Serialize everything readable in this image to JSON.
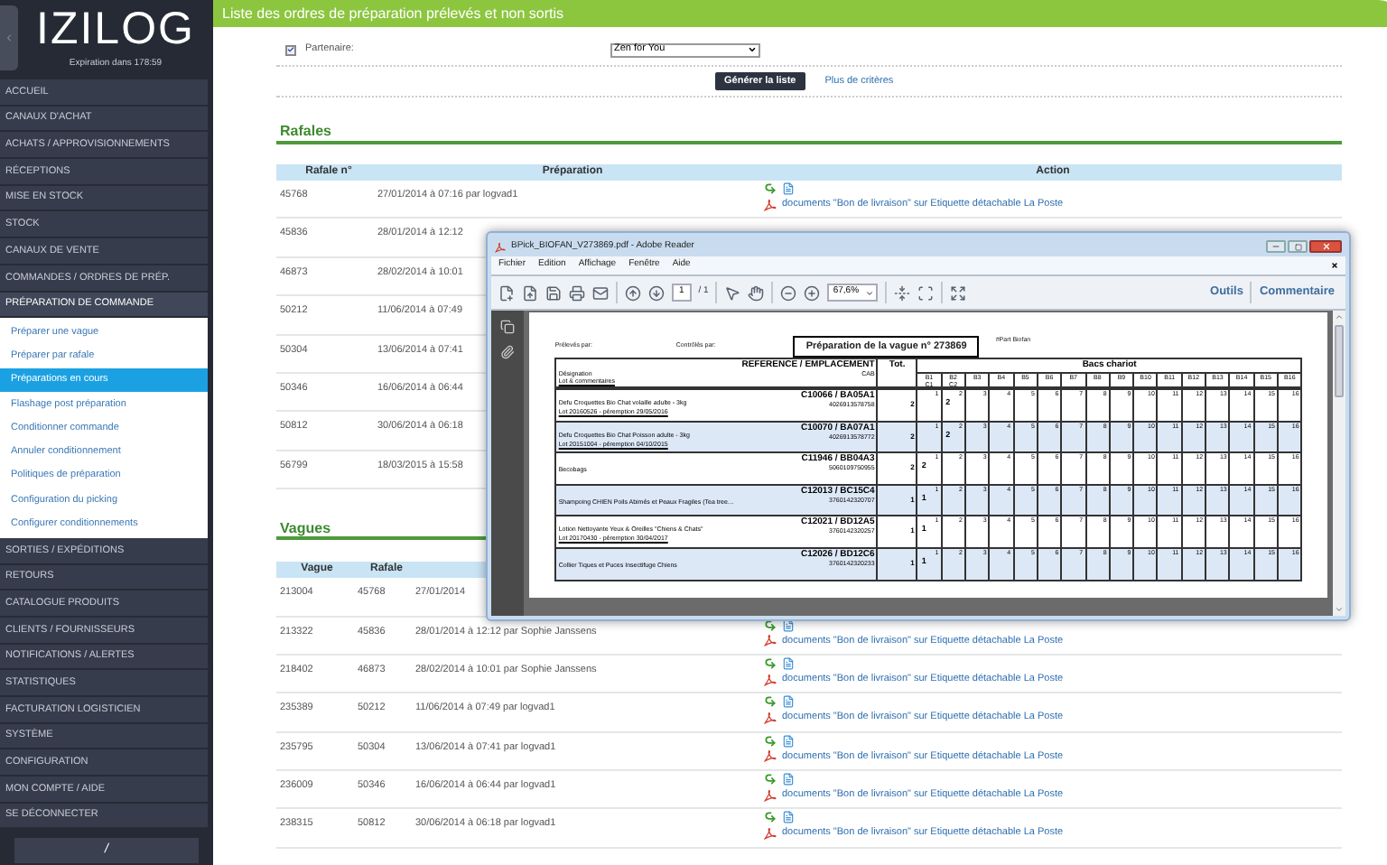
{
  "sidebar": {
    "logo": "IZILOG",
    "expiry": "Expiration dans 178:59",
    "items": [
      {
        "label": "ACCUEIL",
        "expanded": false
      },
      {
        "label": "CANAUX D'ACHAT",
        "expanded": false
      },
      {
        "label": "ACHATS / APPROVISIONNEMENTS",
        "expanded": false
      },
      {
        "label": "RÉCEPTIONS",
        "expanded": false
      },
      {
        "label": "MISE EN STOCK",
        "expanded": false
      },
      {
        "label": "STOCK",
        "expanded": false
      },
      {
        "label": "CANAUX DE VENTE",
        "expanded": false
      },
      {
        "label": "COMMANDES / ORDRES DE PRÉP.",
        "expanded": false
      },
      {
        "label": "PRÉPARATION DE COMMANDE",
        "expanded": true,
        "children": [
          {
            "label": "Préparer une vague",
            "selected": false
          },
          {
            "label": "Préparer par rafale",
            "selected": false
          },
          {
            "label": "Préparations en cours",
            "selected": true
          },
          {
            "label": "Flashage post préparation",
            "selected": false
          },
          {
            "label": "Conditionner commande",
            "selected": false
          },
          {
            "label": "Annuler conditionnement",
            "selected": false
          },
          {
            "label": "Politiques de préparation",
            "selected": false
          },
          {
            "label": "Configuration du picking",
            "selected": false
          },
          {
            "label": "Configurer conditionnements",
            "selected": false
          }
        ]
      },
      {
        "label": "SORTIES / EXPÉDITIONS",
        "expanded": false
      },
      {
        "label": "RETOURS",
        "expanded": false
      },
      {
        "label": "CATALOGUE PRODUITS",
        "expanded": false
      },
      {
        "label": "CLIENTS / FOURNISSEURS",
        "expanded": false
      },
      {
        "label": "NOTIFICATIONS / ALERTES",
        "expanded": false
      },
      {
        "label": "STATISTIQUES",
        "expanded": false
      },
      {
        "label": "FACTURATION LOGISTICIEN",
        "expanded": false
      },
      {
        "label": "SYSTÈME",
        "expanded": false
      },
      {
        "label": "CONFIGURATION",
        "expanded": false
      },
      {
        "label": "MON COMPTE / AIDE",
        "expanded": false
      },
      {
        "label": "SE DÉCONNECTER",
        "expanded": false
      }
    ],
    "footer": "/"
  },
  "header": {
    "title": "Liste des ordres de préparation prélevés et non sortis"
  },
  "filter": {
    "checked": true,
    "label": "Partenaire:",
    "value": "Zen for You",
    "button": "Générer la liste",
    "more_link": "Plus de critères"
  },
  "rafales": {
    "title": "Rafales",
    "columns": [
      "Rafale n°",
      "Préparation",
      "Action"
    ],
    "rows": [
      {
        "id": "45768",
        "preparation": "27/01/2014 à 07:16 par logvad1",
        "link": "documents \"Bon de livraison\" sur Etiquette détachable La Poste"
      },
      {
        "id": "45836",
        "preparation": "28/01/2014 à 12:12"
      },
      {
        "id": "46873",
        "preparation": "28/02/2014 à 10:01"
      },
      {
        "id": "50212",
        "preparation": "11/06/2014 à 07:49"
      },
      {
        "id": "50304",
        "preparation": "13/06/2014 à 07:41"
      },
      {
        "id": "50346",
        "preparation": "16/06/2014 à 06:44"
      },
      {
        "id": "50812",
        "preparation": "30/06/2014 à 06:18"
      },
      {
        "id": "56799",
        "preparation": "18/03/2015 à 15:58"
      }
    ]
  },
  "vagues": {
    "title": "Vagues",
    "columns": [
      "Vague",
      "Rafale"
    ],
    "rows": [
      {
        "vague": "213004",
        "rafale": "45768",
        "preparation": "27/01/2014"
      },
      {
        "vague": "213322",
        "rafale": "45836",
        "preparation": "28/01/2014 à 12:12 par Sophie Janssens",
        "link": "documents \"Bon de livraison\" sur Etiquette détachable La Poste"
      },
      {
        "vague": "218402",
        "rafale": "46873",
        "preparation": "28/02/2014 à 10:01 par Sophie Janssens",
        "link": "documents \"Bon de livraison\" sur Etiquette détachable La Poste"
      },
      {
        "vague": "235389",
        "rafale": "50212",
        "preparation": "11/06/2014 à 07:49 par logvad1",
        "link": "documents \"Bon de livraison\" sur Etiquette détachable La Poste"
      },
      {
        "vague": "235795",
        "rafale": "50304",
        "preparation": "13/06/2014 à 07:41 par logvad1",
        "link": "documents \"Bon de livraison\" sur Etiquette détachable La Poste"
      },
      {
        "vague": "236009",
        "rafale": "50346",
        "preparation": "16/06/2014 à 06:44 par logvad1",
        "link": "documents \"Bon de livraison\" sur Etiquette détachable La Poste"
      },
      {
        "vague": "238315",
        "rafale": "50812",
        "preparation": "30/06/2014 à 06:18 par logvad1",
        "link": "documents \"Bon de livraison\" sur Etiquette détachable La Poste"
      }
    ]
  },
  "pdf_window": {
    "title": "BPick_BIOFAN_V273869.pdf - Adobe Reader",
    "menu": [
      "Fichier",
      "Edition",
      "Affichage",
      "Fenêtre",
      "Aide"
    ],
    "page": "1",
    "page_total": "/ 1",
    "zoom": "67,6%",
    "tools": "Outils",
    "comment": "Commentaire",
    "doc": {
      "picked_by": "Prélevés par:",
      "checked_by": "Contrôlés par:",
      "heading": "Préparation de la vague n° 273869",
      "partner": "#Part Biofan",
      "col_ref": "REFERENCE / EMPLACEMENT",
      "col_designation": "Désignation",
      "col_cab": "CAB",
      "col_lot": "Lot & commentaires",
      "col_total": "Tot.",
      "col_bins": "Bacs chariot",
      "bins": [
        {
          "label": "B1",
          "sub": "C1"
        },
        {
          "label": "B2",
          "sub": "C2"
        },
        {
          "label": "B3"
        },
        {
          "label": "B4"
        },
        {
          "label": "B5"
        },
        {
          "label": "B6"
        },
        {
          "label": "B7"
        },
        {
          "label": "B8"
        },
        {
          "label": "B9"
        },
        {
          "label": "B10"
        },
        {
          "label": "B11"
        },
        {
          "label": "B12"
        },
        {
          "label": "B13"
        },
        {
          "label": "B14"
        },
        {
          "label": "B15"
        },
        {
          "label": "B16"
        }
      ],
      "rows": [
        {
          "designation": "Defu Croquettes Bio Chat volaille adulte - 3kg",
          "lot": "Lot 20160526 - péremption 29/05/2016",
          "ref": "C10066 / BA05A1",
          "cab": "4026913578758",
          "total": "2",
          "cells": [
            {
              "n": "1"
            },
            {
              "n": "2",
              "qty": "2"
            },
            {
              "n": "3"
            },
            {
              "n": "4"
            },
            {
              "n": "5"
            },
            {
              "n": "6"
            },
            {
              "n": "7"
            },
            {
              "n": "8"
            },
            {
              "n": "9"
            },
            {
              "n": "10"
            },
            {
              "n": "11"
            },
            {
              "n": "12"
            },
            {
              "n": "13"
            },
            {
              "n": "14"
            },
            {
              "n": "15"
            },
            {
              "n": "16"
            }
          ]
        },
        {
          "designation": "Defu Croquettes Bio Chat Poisson adulte - 3kg",
          "lot": "Lot 20151004 - péremption 04/10/2015",
          "ref": "C10070 / BA07A1",
          "cab": "4026913578772",
          "total": "2",
          "cells": [
            {
              "n": "1"
            },
            {
              "n": "2",
              "qty": "2"
            },
            {
              "n": "3"
            },
            {
              "n": "4"
            },
            {
              "n": "5"
            },
            {
              "n": "6"
            },
            {
              "n": "7"
            },
            {
              "n": "8"
            },
            {
              "n": "9"
            },
            {
              "n": "10"
            },
            {
              "n": "11"
            },
            {
              "n": "12"
            },
            {
              "n": "13"
            },
            {
              "n": "14"
            },
            {
              "n": "15"
            },
            {
              "n": "16"
            }
          ]
        },
        {
          "designation": "Becobags",
          "ref": "C11946 / BB04A3",
          "cab": "5060109750955",
          "total": "2",
          "cells": [
            {
              "n": "1",
              "qty": "2"
            },
            {
              "n": "2"
            },
            {
              "n": "3"
            },
            {
              "n": "4"
            },
            {
              "n": "5"
            },
            {
              "n": "6"
            },
            {
              "n": "7"
            },
            {
              "n": "8"
            },
            {
              "n": "9"
            },
            {
              "n": "10"
            },
            {
              "n": "11"
            },
            {
              "n": "12"
            },
            {
              "n": "13"
            },
            {
              "n": "14"
            },
            {
              "n": "15"
            },
            {
              "n": "16"
            }
          ]
        },
        {
          "designation": "Shampoing CHIEN Poils Abimés et Peaux Fragiles (Tea tree…",
          "ref": "C12013 / BC15C4",
          "cab": "3760142320707",
          "total": "1",
          "cells": [
            {
              "n": "1",
              "qty": "1"
            },
            {
              "n": "2"
            },
            {
              "n": "3"
            },
            {
              "n": "4"
            },
            {
              "n": "5"
            },
            {
              "n": "6"
            },
            {
              "n": "7"
            },
            {
              "n": "8"
            },
            {
              "n": "9"
            },
            {
              "n": "10"
            },
            {
              "n": "11"
            },
            {
              "n": "12"
            },
            {
              "n": "13"
            },
            {
              "n": "14"
            },
            {
              "n": "15"
            },
            {
              "n": "16"
            }
          ]
        },
        {
          "designation": "Lotion Nettoyante Yeux & Oreilles \"Chiens & Chats\"",
          "lot": "Lot 20170430 - péremption 30/04/2017",
          "ref": "C12021 / BD12A5",
          "cab": "3760142320257",
          "total": "1",
          "cells": [
            {
              "n": "1",
              "qty": "1"
            },
            {
              "n": "2"
            },
            {
              "n": "3"
            },
            {
              "n": "4"
            },
            {
              "n": "5"
            },
            {
              "n": "6"
            },
            {
              "n": "7"
            },
            {
              "n": "8"
            },
            {
              "n": "9"
            },
            {
              "n": "10"
            },
            {
              "n": "11"
            },
            {
              "n": "12"
            },
            {
              "n": "13"
            },
            {
              "n": "14"
            },
            {
              "n": "15"
            },
            {
              "n": "16"
            }
          ]
        },
        {
          "designation": "Collier Tiques et Puces Insectifuge Chiens",
          "ref": "C12026 / BD12C6",
          "cab": "3760142320233",
          "total": "1",
          "cells": [
            {
              "n": "1",
              "qty": "1"
            },
            {
              "n": "2"
            },
            {
              "n": "3"
            },
            {
              "n": "4"
            },
            {
              "n": "5"
            },
            {
              "n": "6"
            },
            {
              "n": "7"
            },
            {
              "n": "8"
            },
            {
              "n": "9"
            },
            {
              "n": "10"
            },
            {
              "n": "11"
            },
            {
              "n": "12"
            },
            {
              "n": "13"
            },
            {
              "n": "14"
            },
            {
              "n": "15"
            },
            {
              "n": "16"
            }
          ]
        }
      ]
    }
  }
}
